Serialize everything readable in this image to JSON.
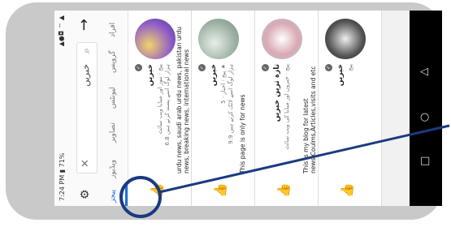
{
  "status": {
    "time": "7:24 PM",
    "battery": "71%",
    "signal": "▲●◘ ⌔ ▲"
  },
  "search": {
    "query": "خبریں",
    "back_icon": "arrow-right-icon",
    "filter_icon": "filter-icon"
  },
  "tabs": [
    {
      "label": "پیجز",
      "active": true
    },
    {
      "label": "ویڈیوز",
      "active": false
    },
    {
      "label": "تصاویر",
      "active": false
    },
    {
      "label": "لیونٹس",
      "active": false
    },
    {
      "label": "گروپس",
      "active": false
    },
    {
      "label": "افراد",
      "active": false
    }
  ],
  "pages": [
    {
      "name": "خبریں",
      "meta1": "پیج · نیوز اور میڈیا ویب سائٹ",
      "meta2": "6.8 ہزار لوگ اسے پسند کرتے ہیں",
      "desc": "urdu news, saudi arab urdu news, pakistan urdu news, breaking news, international news",
      "avatar_color": "#8d5bc9"
    },
    {
      "name": "خبریں",
      "meta1": "پیج · اخبار · 5 ★",
      "meta2": "9.9 ہزار لوگ اسے لائک کرتے ہیں",
      "desc": "This page is only for news",
      "avatar_color": "#9bb0a2"
    },
    {
      "name": "تازہ ترین خبریں",
      "meta1": "پیج · خبروں اور میڈیا کی ویب سائٹ",
      "meta2": "",
      "desc": "This is my blog for latest news,Coulms,Articles,visits and etc",
      "avatar_color": "#d9aab3"
    },
    {
      "name": "خبریں",
      "meta1": "پیج",
      "meta2": "",
      "desc": "",
      "avatar_color": "#555555"
    }
  ],
  "icons": {
    "like": "like-icon",
    "nav_back": "nav-back-icon",
    "nav_home": "nav-home-icon",
    "nav_recent": "nav-recent-icon"
  },
  "colors": {
    "accent": "#1e6fe0",
    "highlight": "#1a3a80"
  }
}
